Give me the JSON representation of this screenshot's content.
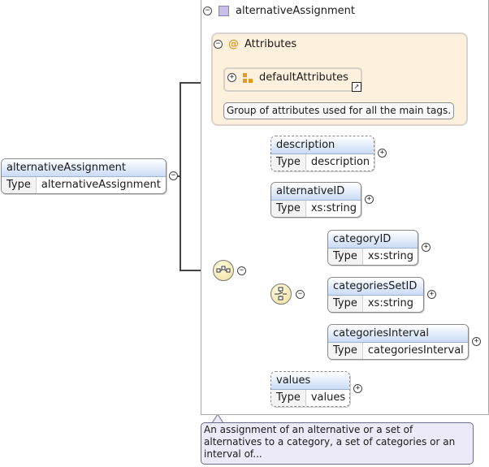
{
  "root": {
    "name": "alternativeAssignment",
    "type_label": "Type",
    "type_value": "alternativeAssignment"
  },
  "complex_type": {
    "name": "alternativeAssignment"
  },
  "attributes": {
    "title": "Attributes",
    "group_name": "defaultAttributes",
    "group_note": "Group of attributes used for all the main tags."
  },
  "elements": [
    {
      "name": "description",
      "type_label": "Type",
      "type_value": "description"
    },
    {
      "name": "alternativeID",
      "type_label": "Type",
      "type_value": "xs:string"
    },
    {
      "name": "categoryID",
      "type_label": "Type",
      "type_value": "xs:string"
    },
    {
      "name": "categoriesSetID",
      "type_label": "Type",
      "type_value": "xs:string"
    },
    {
      "name": "categoriesInterval",
      "type_label": "Type",
      "type_value": "categoriesInterval"
    },
    {
      "name": "values",
      "type_label": "Type",
      "type_value": "values"
    }
  ],
  "main_note": "An assignment of an alternative or a set of alternatives to a category, a set of categories or an interval of...",
  "icons": {
    "collapse": "minus-icon",
    "expand": "plus-icon",
    "complex_type": "complex-type-icon",
    "attribute": "at-icon",
    "attribute_group": "attribute-group-icon",
    "reference": "reference-arrow-icon",
    "sequence": "sequence-compositor-icon",
    "choice": "choice-compositor-icon"
  },
  "colors": {
    "element_header": "#c9dbf6",
    "attributes_bg": "#fdf0dc",
    "note_bg": "#ece9f8",
    "compositor": "#efdf9a"
  }
}
